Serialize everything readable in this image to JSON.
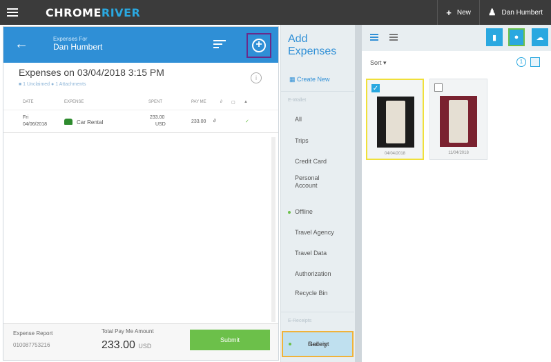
{
  "topbar": {
    "logo_main": "CHROME",
    "logo_accent": "RIVER",
    "new_label": "New",
    "user_name": "Dan Humbert"
  },
  "report": {
    "header_sub": "Expenses For",
    "header_name": "Dan Humbert",
    "title": "Expenses on 03/04/2018 3:15 PM",
    "meta": "■ 1 Unclaimed   ● 1 Attachments",
    "columns": [
      "DATE",
      "EXPENSE",
      "SPENT",
      "PAY ME"
    ],
    "row": {
      "date_day": "Fri",
      "date": "04/06/2018",
      "expense": "Car Rental",
      "spent": "233.00",
      "spent_currency": "USD",
      "pay_me": "233.00"
    },
    "footer": {
      "report_label": "Expense Report",
      "report_id": "010087753216",
      "total_label": "Total Pay Me Amount",
      "total_amount": "233.00",
      "total_currency": "USD",
      "submit_label": "Submit"
    }
  },
  "add_panel": {
    "title_line1": "Add",
    "title_line2": "Expenses",
    "create_new": "Create New",
    "section_wallet": "E-Wallet",
    "items": [
      "All",
      "Trips",
      "Credit Card",
      "Personal Account",
      "Offline",
      "Travel Agency",
      "Travel Data",
      "Authorization",
      "Recycle Bin"
    ],
    "section_receipts": "E-Receipts",
    "gallery_line1": "Receipt",
    "gallery_line2": "Gallery"
  },
  "gallery": {
    "sort_label": "Sort",
    "count": "1",
    "cards": [
      {
        "date": "04/04/2018",
        "checked": true
      },
      {
        "date": "11/04/2018",
        "checked": false
      }
    ]
  }
}
